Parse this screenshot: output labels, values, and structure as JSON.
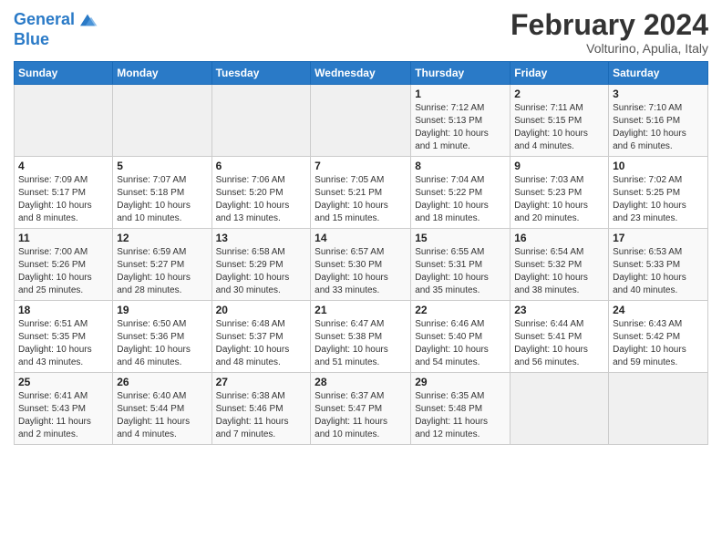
{
  "logo": {
    "line1": "General",
    "line2": "Blue"
  },
  "title": "February 2024",
  "subtitle": "Volturino, Apulia, Italy",
  "days_of_week": [
    "Sunday",
    "Monday",
    "Tuesday",
    "Wednesday",
    "Thursday",
    "Friday",
    "Saturday"
  ],
  "weeks": [
    [
      {
        "day": "",
        "info": ""
      },
      {
        "day": "",
        "info": ""
      },
      {
        "day": "",
        "info": ""
      },
      {
        "day": "",
        "info": ""
      },
      {
        "day": "1",
        "info": "Sunrise: 7:12 AM\nSunset: 5:13 PM\nDaylight: 10 hours\nand 1 minute."
      },
      {
        "day": "2",
        "info": "Sunrise: 7:11 AM\nSunset: 5:15 PM\nDaylight: 10 hours\nand 4 minutes."
      },
      {
        "day": "3",
        "info": "Sunrise: 7:10 AM\nSunset: 5:16 PM\nDaylight: 10 hours\nand 6 minutes."
      }
    ],
    [
      {
        "day": "4",
        "info": "Sunrise: 7:09 AM\nSunset: 5:17 PM\nDaylight: 10 hours\nand 8 minutes."
      },
      {
        "day": "5",
        "info": "Sunrise: 7:07 AM\nSunset: 5:18 PM\nDaylight: 10 hours\nand 10 minutes."
      },
      {
        "day": "6",
        "info": "Sunrise: 7:06 AM\nSunset: 5:20 PM\nDaylight: 10 hours\nand 13 minutes."
      },
      {
        "day": "7",
        "info": "Sunrise: 7:05 AM\nSunset: 5:21 PM\nDaylight: 10 hours\nand 15 minutes."
      },
      {
        "day": "8",
        "info": "Sunrise: 7:04 AM\nSunset: 5:22 PM\nDaylight: 10 hours\nand 18 minutes."
      },
      {
        "day": "9",
        "info": "Sunrise: 7:03 AM\nSunset: 5:23 PM\nDaylight: 10 hours\nand 20 minutes."
      },
      {
        "day": "10",
        "info": "Sunrise: 7:02 AM\nSunset: 5:25 PM\nDaylight: 10 hours\nand 23 minutes."
      }
    ],
    [
      {
        "day": "11",
        "info": "Sunrise: 7:00 AM\nSunset: 5:26 PM\nDaylight: 10 hours\nand 25 minutes."
      },
      {
        "day": "12",
        "info": "Sunrise: 6:59 AM\nSunset: 5:27 PM\nDaylight: 10 hours\nand 28 minutes."
      },
      {
        "day": "13",
        "info": "Sunrise: 6:58 AM\nSunset: 5:29 PM\nDaylight: 10 hours\nand 30 minutes."
      },
      {
        "day": "14",
        "info": "Sunrise: 6:57 AM\nSunset: 5:30 PM\nDaylight: 10 hours\nand 33 minutes."
      },
      {
        "day": "15",
        "info": "Sunrise: 6:55 AM\nSunset: 5:31 PM\nDaylight: 10 hours\nand 35 minutes."
      },
      {
        "day": "16",
        "info": "Sunrise: 6:54 AM\nSunset: 5:32 PM\nDaylight: 10 hours\nand 38 minutes."
      },
      {
        "day": "17",
        "info": "Sunrise: 6:53 AM\nSunset: 5:33 PM\nDaylight: 10 hours\nand 40 minutes."
      }
    ],
    [
      {
        "day": "18",
        "info": "Sunrise: 6:51 AM\nSunset: 5:35 PM\nDaylight: 10 hours\nand 43 minutes."
      },
      {
        "day": "19",
        "info": "Sunrise: 6:50 AM\nSunset: 5:36 PM\nDaylight: 10 hours\nand 46 minutes."
      },
      {
        "day": "20",
        "info": "Sunrise: 6:48 AM\nSunset: 5:37 PM\nDaylight: 10 hours\nand 48 minutes."
      },
      {
        "day": "21",
        "info": "Sunrise: 6:47 AM\nSunset: 5:38 PM\nDaylight: 10 hours\nand 51 minutes."
      },
      {
        "day": "22",
        "info": "Sunrise: 6:46 AM\nSunset: 5:40 PM\nDaylight: 10 hours\nand 54 minutes."
      },
      {
        "day": "23",
        "info": "Sunrise: 6:44 AM\nSunset: 5:41 PM\nDaylight: 10 hours\nand 56 minutes."
      },
      {
        "day": "24",
        "info": "Sunrise: 6:43 AM\nSunset: 5:42 PM\nDaylight: 10 hours\nand 59 minutes."
      }
    ],
    [
      {
        "day": "25",
        "info": "Sunrise: 6:41 AM\nSunset: 5:43 PM\nDaylight: 11 hours\nand 2 minutes."
      },
      {
        "day": "26",
        "info": "Sunrise: 6:40 AM\nSunset: 5:44 PM\nDaylight: 11 hours\nand 4 minutes."
      },
      {
        "day": "27",
        "info": "Sunrise: 6:38 AM\nSunset: 5:46 PM\nDaylight: 11 hours\nand 7 minutes."
      },
      {
        "day": "28",
        "info": "Sunrise: 6:37 AM\nSunset: 5:47 PM\nDaylight: 11 hours\nand 10 minutes."
      },
      {
        "day": "29",
        "info": "Sunrise: 6:35 AM\nSunset: 5:48 PM\nDaylight: 11 hours\nand 12 minutes."
      },
      {
        "day": "",
        "info": ""
      },
      {
        "day": "",
        "info": ""
      }
    ]
  ]
}
